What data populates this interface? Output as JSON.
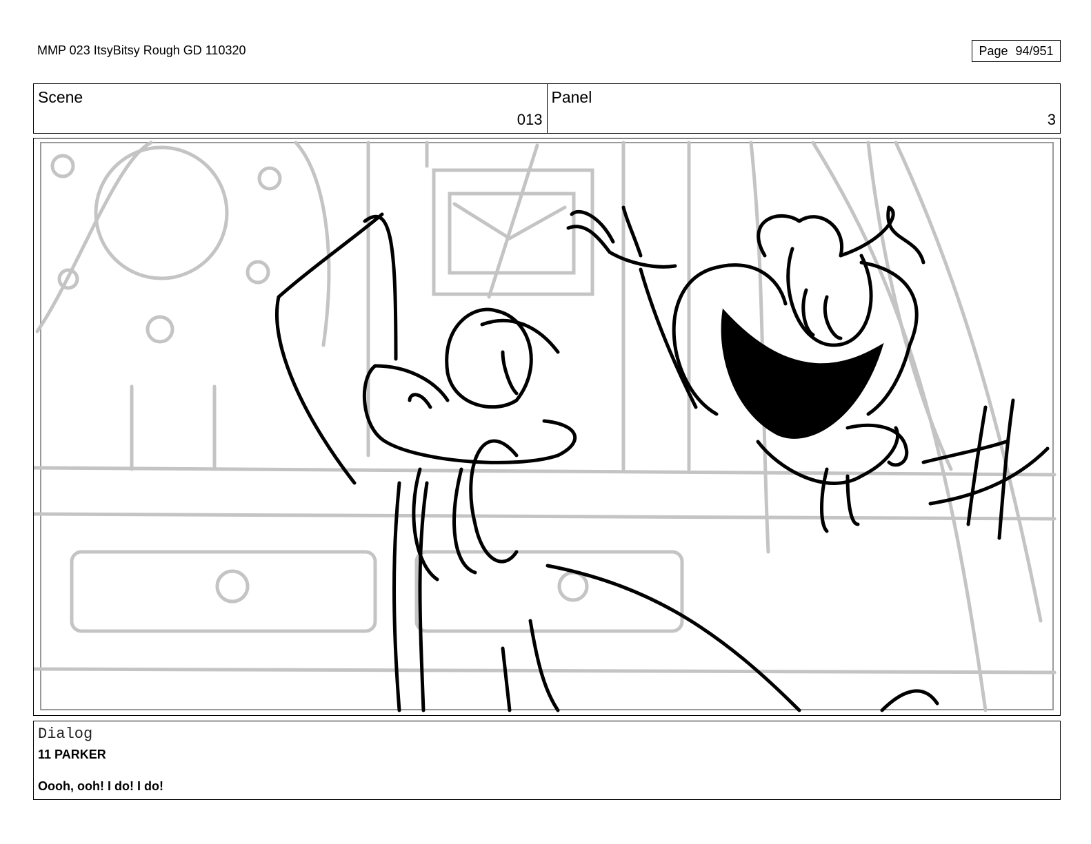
{
  "document": {
    "title": "MMP 023 ItsyBitsy Rough GD 110320",
    "page_label": "Page",
    "page_number": "94/951"
  },
  "header": {
    "scene_label": "Scene",
    "scene_value": "013",
    "panel_label": "Panel",
    "panel_value": "3"
  },
  "dialog": {
    "label": "Dialog",
    "speaker": "11 PARKER",
    "line": "Oooh, ooh! I do! I do!"
  }
}
